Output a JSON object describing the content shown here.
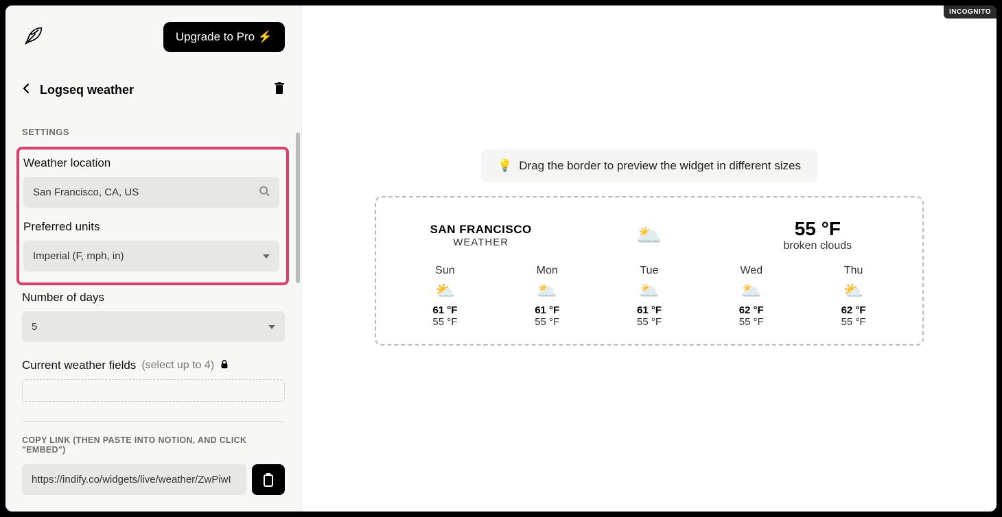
{
  "incognito_label": "INCOGNITO",
  "header": {
    "upgrade_label": "Upgrade to Pro ⚡"
  },
  "nav": {
    "widget_title": "Logseq weather"
  },
  "settings": {
    "section_label": "SETTINGS",
    "location_label": "Weather location",
    "location_value": "San Francisco, CA, US",
    "units_label": "Preferred units",
    "units_value": "Imperial (F, mph, in)",
    "days_label": "Number of days",
    "days_value": "5",
    "current_fields_label": "Current weather fields",
    "current_fields_hint": "(select up to 4)"
  },
  "copy": {
    "label": "COPY LINK (THEN PASTE INTO NOTION, AND CLICK \"EMBED\")",
    "url": "https://indify.co/widgets/live/weather/ZwPiwI"
  },
  "preview": {
    "hint": "Drag the border to preview the widget in different sizes",
    "city": "SAN FRANCISCO",
    "subtitle": "WEATHER",
    "current_temp": "55 °F",
    "condition": "broken clouds",
    "forecast": [
      {
        "day": "Sun",
        "icon": "⛅",
        "hi": "61 °F",
        "lo": "55 °F"
      },
      {
        "day": "Mon",
        "icon": "🌥️",
        "hi": "61 °F",
        "lo": "55 °F"
      },
      {
        "day": "Tue",
        "icon": "🌥️",
        "hi": "61 °F",
        "lo": "55 °F"
      },
      {
        "day": "Wed",
        "icon": "🌥️",
        "hi": "62 °F",
        "lo": "55 °F"
      },
      {
        "day": "Thu",
        "icon": "⛅",
        "hi": "62 °F",
        "lo": "55 °F"
      }
    ]
  }
}
